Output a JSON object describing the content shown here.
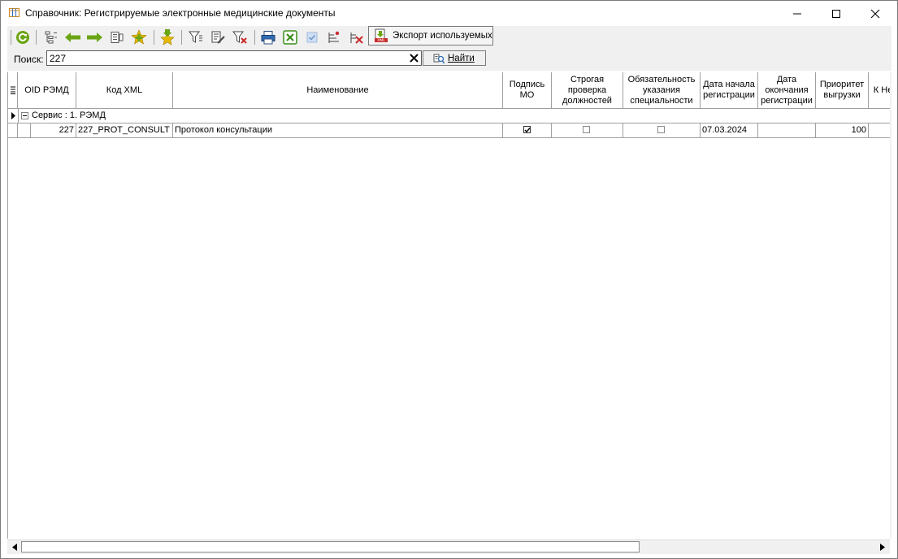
{
  "window": {
    "title": "Справочник: Регистрируемые электронные медицинские документы"
  },
  "toolbar": {
    "export_label": "Экспорт используемых"
  },
  "search": {
    "label": "Поиск:",
    "value": "227",
    "find_label": "Найти"
  },
  "grid": {
    "columns": [
      "OID РЭМД",
      "Код XML",
      "Наименование",
      "Подпись МО",
      "Строгая проверка должностей",
      "Обязательность указания специальности",
      "Дата начала регистрации",
      "Дата окончания регистрации",
      "Приоритет выгрузки",
      "К Нет"
    ],
    "group_label": "Сервис : 1. РЭМД",
    "rows": [
      {
        "oid": "227",
        "code": "227_PROT_CONSULT",
        "name": "Протокол консультации",
        "signature_mo": true,
        "strict_check": false,
        "specialty_required": false,
        "start_date": "07.03.2024",
        "end_date": "",
        "priority": "100"
      }
    ]
  },
  "colors": {
    "toolbar_bg": "#f0f0f0",
    "grid_line": "#a0a0a0",
    "icon_green": "#6aa513",
    "icon_blue": "#2f6db5",
    "icon_red": "#c82b2b",
    "icon_yellow": "#e5b800"
  }
}
